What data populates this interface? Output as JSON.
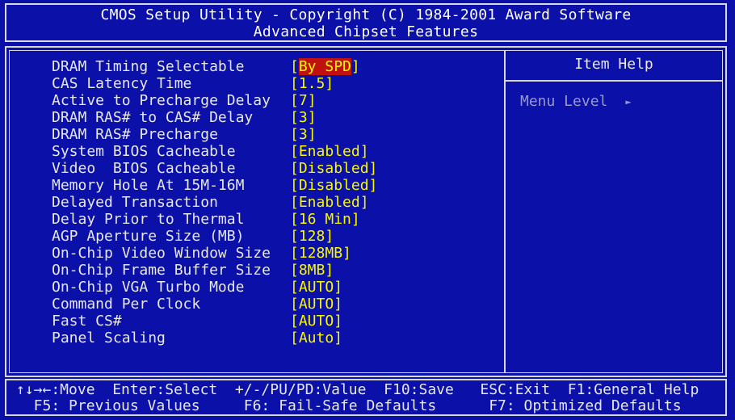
{
  "header": {
    "title_line1": "CMOS Setup Utility - Copyright (C) 1984-2001 Award Software",
    "title_line2": "Advanced Chipset Features"
  },
  "settings": [
    {
      "label": "DRAM Timing Selectable",
      "value": "By SPD",
      "selected": true
    },
    {
      "label": "CAS Latency Time",
      "value": "1.5"
    },
    {
      "label": "Active to Precharge Delay",
      "value": "7"
    },
    {
      "label": "DRAM RAS# to CAS# Delay",
      "value": "3"
    },
    {
      "label": "DRAM RAS# Precharge",
      "value": "3"
    },
    {
      "label": "System BIOS Cacheable",
      "value": "Enabled"
    },
    {
      "label": "Video  BIOS Cacheable",
      "value": "Disabled"
    },
    {
      "label": "Memory Hole At 15M-16M",
      "value": "Disabled"
    },
    {
      "label": "Delayed Transaction",
      "value": "Enabled"
    },
    {
      "label": "Delay Prior to Thermal",
      "value": "16 Min"
    },
    {
      "label": "AGP Aperture Size (MB)",
      "value": "128"
    },
    {
      "label": "On-Chip Video Window Size",
      "value": "128MB"
    },
    {
      "label": "On-Chip Frame Buffer Size",
      "value": "8MB"
    },
    {
      "label": "On-Chip VGA Turbo Mode",
      "value": "AUTO"
    },
    {
      "label": "Command Per Clock",
      "value": "AUTO"
    },
    {
      "label": "Fast CS#",
      "value": "AUTO"
    },
    {
      "label": "Panel Scaling",
      "value": "Auto"
    }
  ],
  "help": {
    "title": "Item Help",
    "menu_level_label": "Menu Level",
    "menu_level_arrow": "►"
  },
  "footer": {
    "line1": "↑↓→←:Move  Enter:Select  +/-/PU/PD:Value  F10:Save   ESC:Exit  F1:General Help",
    "line2": "  F5: Previous Values     F6: Fail-Safe Defaults      F7: Optimized Defaults"
  },
  "colors": {
    "background": "#0a10a8",
    "label": "#e8e8e8",
    "value": "#f8f800",
    "highlight": "#c01010",
    "dim": "#9898c8"
  }
}
